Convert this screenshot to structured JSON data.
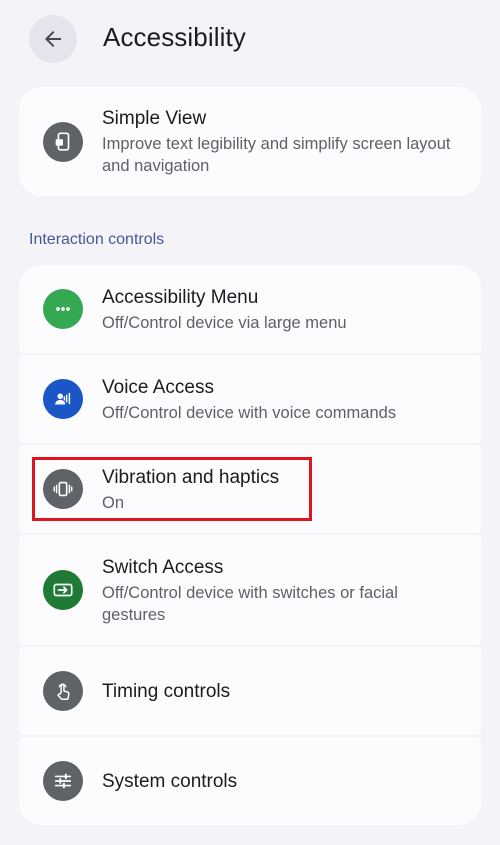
{
  "header": {
    "title": "Accessibility"
  },
  "simple_view": {
    "title": "Simple View",
    "subtitle": "Improve text legibility and simplify screen layout and navigation"
  },
  "section": {
    "label": "Interaction controls"
  },
  "items": [
    {
      "title": "Accessibility Menu",
      "subtitle": "Off/Control device via large menu",
      "icon": "more-dots-icon",
      "color": "#34a853"
    },
    {
      "title": "Voice Access",
      "subtitle": "Off/Control device with voice commands",
      "icon": "voice-access-icon",
      "color": "#1a56c6"
    },
    {
      "title": "Vibration and haptics",
      "subtitle": "On",
      "icon": "vibration-icon",
      "color": "#5f6368"
    },
    {
      "title": "Switch Access",
      "subtitle": "Off/Control device with switches or facial gestures",
      "icon": "switch-access-icon",
      "color": "#1e7a34"
    },
    {
      "title": "Timing controls",
      "subtitle": "",
      "icon": "touch-timer-icon",
      "color": "#5f6368"
    },
    {
      "title": "System controls",
      "subtitle": "",
      "icon": "sliders-icon",
      "color": "#5f6368"
    }
  ],
  "colors": {
    "highlight": "#e0141e",
    "section_label": "#48579c"
  }
}
